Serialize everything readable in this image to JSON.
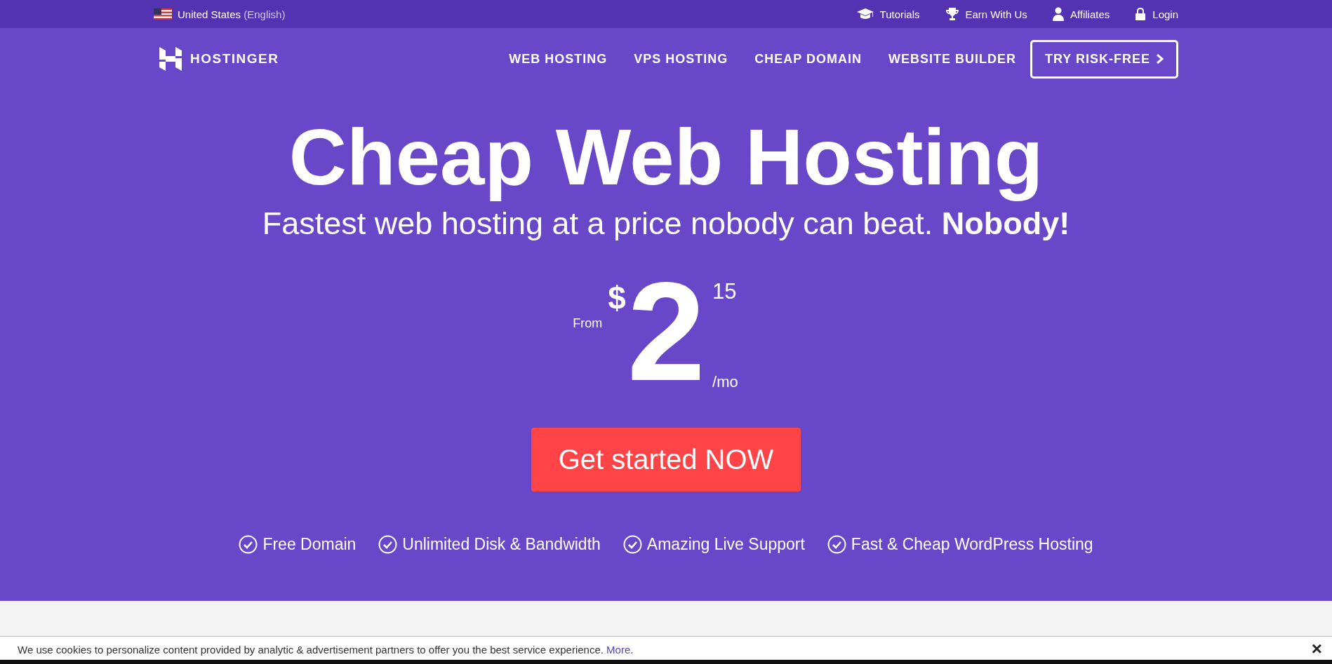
{
  "topbar": {
    "locale": "United States",
    "language": "(English)",
    "links": [
      {
        "label": "Tutorials",
        "kind": "cap"
      },
      {
        "label": "Earn With Us",
        "kind": "trophy"
      },
      {
        "label": "Affiliates",
        "kind": "user"
      },
      {
        "label": "Login",
        "kind": "lock"
      }
    ]
  },
  "nav": {
    "logo": "HOSTINGER",
    "items": [
      "WEB HOSTING",
      "VPS HOSTING",
      "CHEAP DOMAIN",
      "WEBSITE BUILDER"
    ],
    "cta": "TRY RISK-FREE"
  },
  "hero": {
    "title": "Cheap Web Hosting",
    "subtitle": "Fastest web hosting at a price nobody can beat. **Nobody!**",
    "price": {
      "prefix": "From",
      "currency": "$",
      "whole": "2",
      "cents": "15",
      "period": "/mo"
    },
    "button": "Get started NOW",
    "features": [
      "Free Domain",
      "Unlimited Disk & Bandwidth",
      "Amazing Live Support",
      "Fast & Cheap WordPress Hosting"
    ]
  },
  "cookie": {
    "text": "We use cookies to personalize content provided by analytic & advertisement partners to offer you the best service experience. ",
    "link": "More",
    "end": ".",
    "close": "×"
  }
}
